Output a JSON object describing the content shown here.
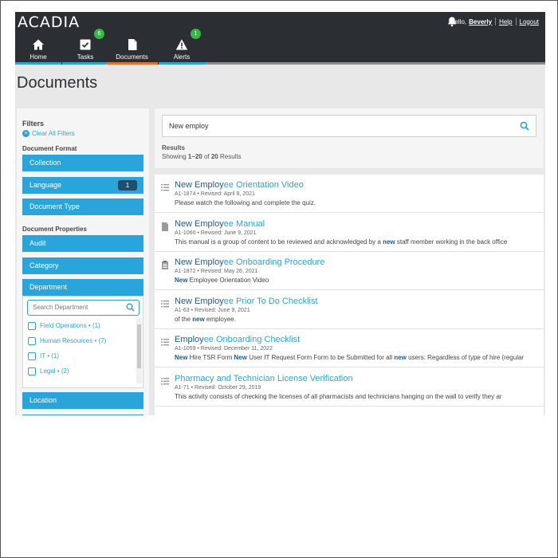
{
  "app": {
    "logo": "ACADIA",
    "greeting": "Hello,",
    "user": "Beverly",
    "help": "Help",
    "logout": "Logout"
  },
  "nav": {
    "tabs": [
      {
        "label": "Home",
        "icon": "home-icon"
      },
      {
        "label": "Tasks",
        "icon": "tasks-icon",
        "badge": "6"
      },
      {
        "label": "Documents",
        "icon": "document-icon",
        "active": true
      },
      {
        "label": "Alerts",
        "icon": "alert-icon",
        "badge": "1"
      }
    ]
  },
  "page": {
    "title": "Documents"
  },
  "filters": {
    "title": "Filters",
    "clear_all": "Clear All Filters",
    "format_label": "Document Format",
    "format_buttons": [
      "Collection",
      "Language",
      "Document Type"
    ],
    "language_count": "1",
    "properties_label": "Document Properties",
    "property_buttons": [
      "Audit",
      "Category",
      "Department"
    ],
    "department": {
      "search_placeholder": "Search Department",
      "items": [
        "Field Operations • (1)",
        "Human Resources • (7)",
        "IT • (1)",
        "Legal • (2)"
      ]
    },
    "location_button": "Location"
  },
  "search": {
    "query": "New employ",
    "results_label": "Results",
    "showing_prefix": "Showing",
    "range": "1–20",
    "of": "of",
    "total": "20",
    "suffix": "Results"
  },
  "results": [
    {
      "icon": "list-icon",
      "title_hl": "New Employ",
      "title_rest": "ee Orientation Video",
      "meta": "A1-1874 • Revised: April 8, 2021",
      "desc": [
        {
          "t": "Please watch the following and complete the quiz.",
          "h": false
        }
      ]
    },
    {
      "icon": "book-icon",
      "title_hl": "New Employ",
      "title_rest": "ee Manual",
      "meta": "A1-1060 • Revised: June 9, 2021",
      "desc": [
        {
          "t": "This manual is a group of content to be reviewed and acknowledged by a ",
          "h": false
        },
        {
          "t": "new",
          "h": true
        },
        {
          "t": " staff member working in the back office",
          "h": false
        }
      ]
    },
    {
      "icon": "clipboard-icon",
      "title_hl": "New Employ",
      "title_rest": "ee Onboarding Procedure",
      "meta": "A1-1872 • Revised: May 26, 2021",
      "desc": [
        {
          "t": "New",
          "h": true
        },
        {
          "t": " Employee Orientation Video",
          "h": false
        }
      ]
    },
    {
      "icon": "list-icon",
      "title_hl": "New Employ",
      "title_rest": "ee Prior To Do Checklist",
      "meta": "A1-63 • Revised: June 9, 2021",
      "desc": [
        {
          "t": "of the ",
          "h": false
        },
        {
          "t": "new",
          "h": true
        },
        {
          "t": " employee.",
          "h": false
        }
      ]
    },
    {
      "icon": "list-icon",
      "title_hl": "Employ",
      "title_rest": "ee Onboarding Checklist",
      "meta": "A1-1059 • Revised: December 11, 2022",
      "desc": [
        {
          "t": "New",
          "h": true
        },
        {
          "t": " Hire TSR Form ",
          "h": false
        },
        {
          "t": "New",
          "h": true
        },
        {
          "t": " User IT Request Form Form to be Submitted for all ",
          "h": false
        },
        {
          "t": "new",
          "h": true
        },
        {
          "t": " users: Regardless of type of hire (regular",
          "h": false
        }
      ]
    },
    {
      "icon": "list-icon",
      "title_hl": "",
      "title_rest": "Pharmacy and Technician License Verification",
      "meta": "A1-71 • Revised: October 29, 2019",
      "desc": [
        {
          "t": "This activity consists of checking the licenses of all pharmacists and technicians hanging on the wall to verify they ar",
          "h": false
        }
      ]
    }
  ],
  "colors": {
    "accent": "#2aa5dc",
    "topbar": "#2b2f33",
    "active_tab": "#e8702a",
    "badge": "#3ab54a"
  }
}
